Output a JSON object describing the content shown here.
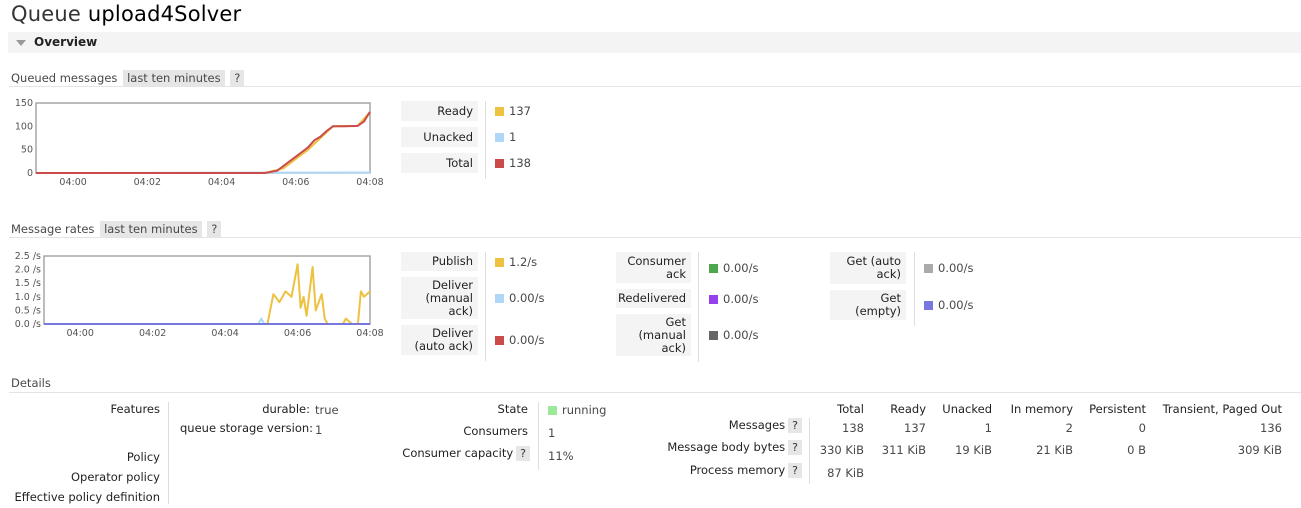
{
  "page": {
    "title_prefix": "Queue",
    "queue_name": "upload4Solver",
    "overview": "Overview"
  },
  "queued": {
    "title": "Queued messages",
    "range": "last ten minutes",
    "help": "?",
    "legend": [
      {
        "label": "Ready",
        "value": "137",
        "color": "#edc240"
      },
      {
        "label": "Unacked",
        "value": "1",
        "color": "#afd8f8"
      },
      {
        "label": "Total",
        "value": "138",
        "color": "#cb4b4b"
      }
    ]
  },
  "rates": {
    "title": "Message rates",
    "range": "last ten minutes",
    "help": "?",
    "col1": [
      {
        "label": "Publish",
        "value": "1.2/s",
        "color": "#edc240"
      },
      {
        "label": "Deliver (manual ack)",
        "value": "0.00/s",
        "color": "#afd8f8"
      },
      {
        "label": "Deliver (auto ack)",
        "value": "0.00/s",
        "color": "#cb4b4b"
      }
    ],
    "col2": [
      {
        "label": "Consumer ack",
        "value": "0.00/s",
        "color": "#4da74d"
      },
      {
        "label": "Redelivered",
        "value": "0.00/s",
        "color": "#9440ed"
      },
      {
        "label": "Get (manual ack)",
        "value": "0.00/s",
        "color": "#666666"
      }
    ],
    "col3": [
      {
        "label": "Get (auto ack)",
        "value": "0.00/s",
        "color": "#aaaaaa"
      },
      {
        "label": "Get (empty)",
        "value": "0.00/s",
        "color": "#7777dd"
      }
    ]
  },
  "chart_data": [
    {
      "type": "line",
      "x_ticks": [
        "04:00",
        "04:02",
        "04:04",
        "04:06",
        "04:08"
      ],
      "y_ticks": [
        "0",
        "50",
        "100",
        "150"
      ],
      "ylim": [
        0,
        150
      ],
      "xlim": [
        "03:59",
        "04:08"
      ],
      "series": [
        {
          "name": "Ready",
          "color": "#edc240",
          "points": [
            [
              "03:59",
              0
            ],
            [
              "04:05:10",
              0
            ],
            [
              "04:05:40",
              10
            ],
            [
              "04:06",
              30
            ],
            [
              "04:06:20",
              50
            ],
            [
              "04:06:40",
              75
            ],
            [
              "04:07",
              100
            ],
            [
              "04:07:40",
              101
            ],
            [
              "04:08",
              131
            ]
          ]
        },
        {
          "name": "Unacked",
          "color": "#afd8f8",
          "points": [
            [
              "03:59",
              0
            ],
            [
              "04:08",
              1
            ]
          ]
        },
        {
          "name": "Total",
          "color": "#cb4b4b",
          "points": [
            [
              "03:59",
              0
            ],
            [
              "04:05:10",
              0
            ],
            [
              "04:05:30",
              5
            ],
            [
              "04:05:40",
              15
            ],
            [
              "04:05:50",
              25
            ],
            [
              "04:06",
              35
            ],
            [
              "04:06:10",
              45
            ],
            [
              "04:06:20",
              55
            ],
            [
              "04:06:30",
              70
            ],
            [
              "04:06:40",
              78
            ],
            [
              "04:06:50",
              90
            ],
            [
              "04:07",
              100
            ],
            [
              "04:07:20",
              100
            ],
            [
              "04:07:40",
              101
            ],
            [
              "04:07:50",
              110
            ],
            [
              "04:08",
              131
            ]
          ]
        }
      ]
    },
    {
      "type": "line",
      "x_ticks": [
        "04:00",
        "04:02",
        "04:04",
        "04:06",
        "04:08"
      ],
      "y_ticks": [
        "0.0 /s",
        "0.5 /s",
        "1.0 /s",
        "1.5 /s",
        "2.0 /s",
        "2.5 /s"
      ],
      "ylim": [
        0,
        2.5
      ],
      "xlim": [
        "03:59",
        "04:08"
      ],
      "series": [
        {
          "name": "Publish",
          "color": "#edc240",
          "points": [
            [
              "03:59",
              0
            ],
            [
              "04:05:10",
              0
            ],
            [
              "04:05:20",
              1.1
            ],
            [
              "04:05:30",
              0.8
            ],
            [
              "04:05:40",
              1.2
            ],
            [
              "04:05:50",
              1.0
            ],
            [
              "04:06",
              2.2
            ],
            [
              "04:06:05",
              0.6
            ],
            [
              "04:06:10",
              1.0
            ],
            [
              "04:06:15",
              0.3
            ],
            [
              "04:06:25",
              2.1
            ],
            [
              "04:06:30",
              0.5
            ],
            [
              "04:06:40",
              1.1
            ],
            [
              "04:06:45",
              0.2
            ],
            [
              "04:06:50",
              0.0
            ],
            [
              "04:07:15",
              0.0
            ],
            [
              "04:07:20",
              0.2
            ],
            [
              "04:07:30",
              0.0
            ],
            [
              "04:07:40",
              0.0
            ],
            [
              "04:07:45",
              1.2
            ],
            [
              "04:07:50",
              1.0
            ],
            [
              "04:08",
              1.2
            ]
          ]
        },
        {
          "name": "Deliver (manual ack)",
          "color": "#afd8f8",
          "points": [
            [
              "03:59",
              0
            ],
            [
              "04:04:55",
              0
            ],
            [
              "04:05",
              0.2
            ],
            [
              "04:05:05",
              0
            ],
            [
              "04:08",
              0
            ]
          ]
        },
        {
          "name": "Get (empty)",
          "color": "#7777dd",
          "points": [
            [
              "03:59",
              0
            ],
            [
              "04:08",
              0
            ]
          ]
        }
      ]
    }
  ],
  "details": {
    "title": "Details",
    "features_label": "Features",
    "features": [
      {
        "key": "durable:",
        "value": "true"
      },
      {
        "key": "queue storage version:",
        "value": "1"
      }
    ],
    "policy_label": "Policy",
    "operator_policy_label": "Operator policy",
    "effective_policy_label": "Effective policy definition",
    "state_label": "State",
    "state_value": "running",
    "state_color": "#9aea9a",
    "consumers_label": "Consumers",
    "consumers_value": "1",
    "capacity_label": "Consumer capacity",
    "capacity_value": "11%",
    "help": "?",
    "table": {
      "headers": [
        "Total",
        "Ready",
        "Unacked",
        "In memory",
        "Persistent",
        "Transient, Paged Out"
      ],
      "rows": [
        {
          "label": "Messages",
          "values": [
            "138",
            "137",
            "1",
            "2",
            "0",
            "136"
          ]
        },
        {
          "label": "Message body bytes",
          "values": [
            "330 KiB",
            "311 KiB",
            "19 KiB",
            "21 KiB",
            "0 B",
            "309 KiB"
          ]
        },
        {
          "label": "Process memory",
          "values": [
            "87 KiB"
          ]
        }
      ]
    }
  }
}
